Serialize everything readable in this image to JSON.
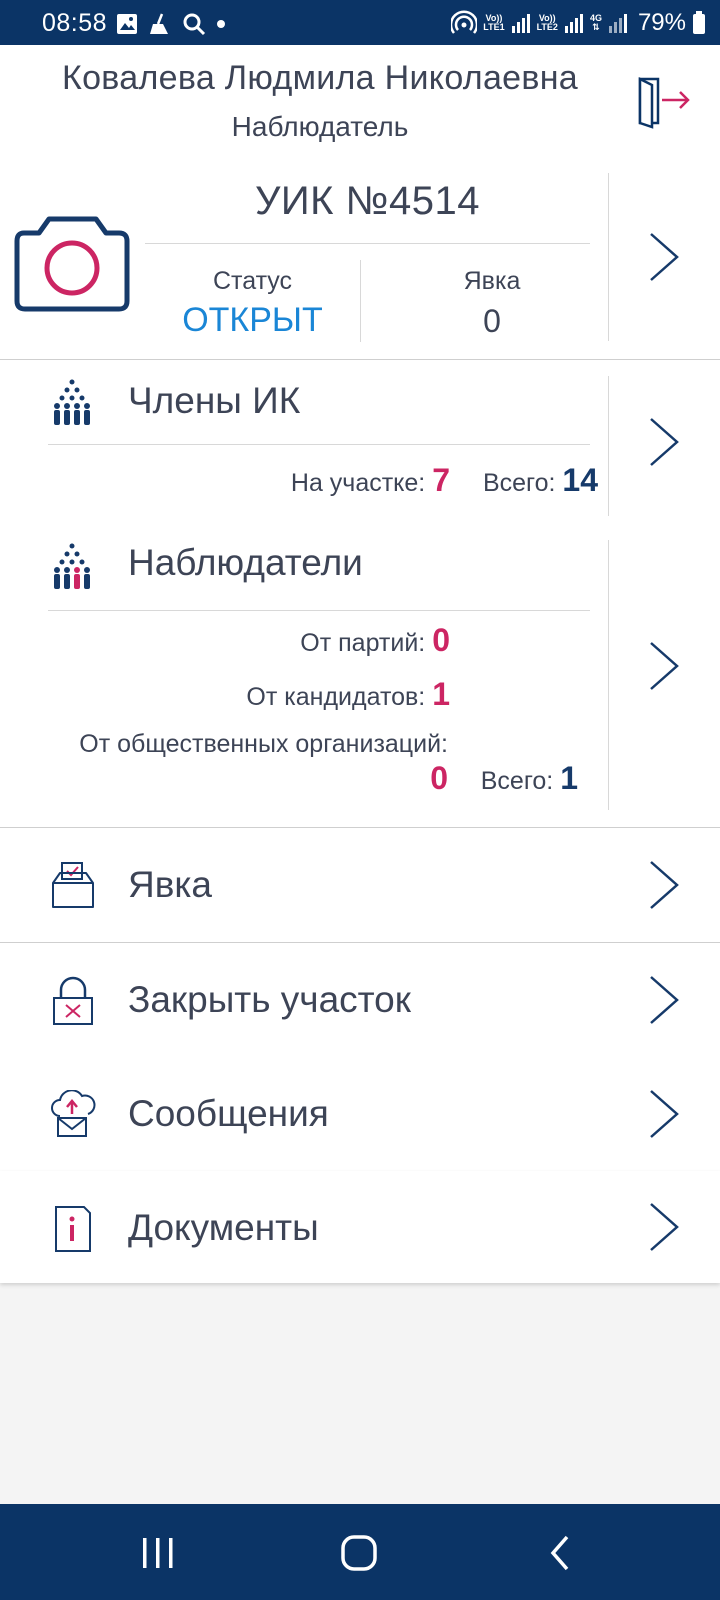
{
  "status_bar": {
    "time": "08:58",
    "sim1_label_top": "Vo))",
    "sim1_label_bottom": "LTE1",
    "sim2_label_top": "Vo))",
    "sim2_label_bottom": "LTE2",
    "network": "4G",
    "battery": "79%"
  },
  "header": {
    "user_name": "Ковалева Людмила Николаевна",
    "role": "Наблюдатель"
  },
  "uik": {
    "title": "УИК №4514",
    "status_label": "Статус",
    "status_value": "ОТКРЫТ",
    "turnout_label": "Явка",
    "turnout_value": "0"
  },
  "members": {
    "title": "Члены ИК",
    "on_site_label": "На участке:",
    "on_site_value": "7",
    "total_label": "Всего:",
    "total_value": "14"
  },
  "observers": {
    "title": "Наблюдатели",
    "parties_label": "От партий:",
    "parties_value": "0",
    "candidates_label": "От кандидатов:",
    "candidates_value": "1",
    "public_orgs_label": "От общественных организаций:",
    "public_orgs_value": "0",
    "total_label": "Всего:",
    "total_value": "1"
  },
  "menu": [
    {
      "label": "Явка",
      "icon": "ballot-box-icon"
    },
    {
      "label": "Закрыть участок",
      "icon": "padlock-icon"
    },
    {
      "label": "Сообщения",
      "icon": "cloud-mail-icon"
    },
    {
      "label": "Документы",
      "icon": "document-info-icon"
    }
  ],
  "colors": {
    "primary_navy": "#0b3466",
    "accent_pink": "#cc2563",
    "status_blue": "#1a86d6",
    "text": "#3d4456"
  }
}
